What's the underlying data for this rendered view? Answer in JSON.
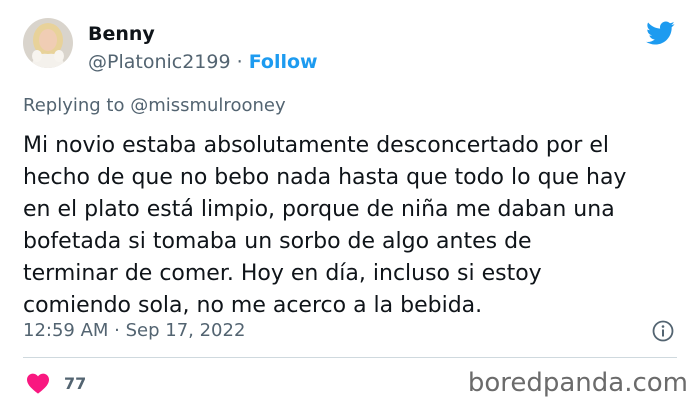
{
  "tweet": {
    "author_name": "Benny",
    "handle": "@Platonic2199",
    "separator": "·",
    "follow_label": "Follow",
    "replying_to": "Replying to @missmulrooney",
    "body_lines": [
      "Mi novio estaba absolutamente desconcertado por el",
      "hecho de que no bebo nada hasta que todo lo que hay",
      "en el plato está limpio, porque de niña me daban una",
      "bofetada si tomaba un sorbo de algo antes de",
      "terminar de comer. Hoy en día, incluso si estoy",
      "comiendo sola, no me acerco a la bebida."
    ],
    "timestamp": "12:59 AM · Sep 17, 2022",
    "like_count": "77"
  },
  "watermark": "boredpanda.com",
  "colors": {
    "twitter_blue": "#1d9bf0",
    "like_red": "#f91880",
    "secondary_text": "#536471"
  },
  "icons": {
    "logo": "twitter-bird-icon",
    "info": "info-icon",
    "like": "heart-icon"
  }
}
